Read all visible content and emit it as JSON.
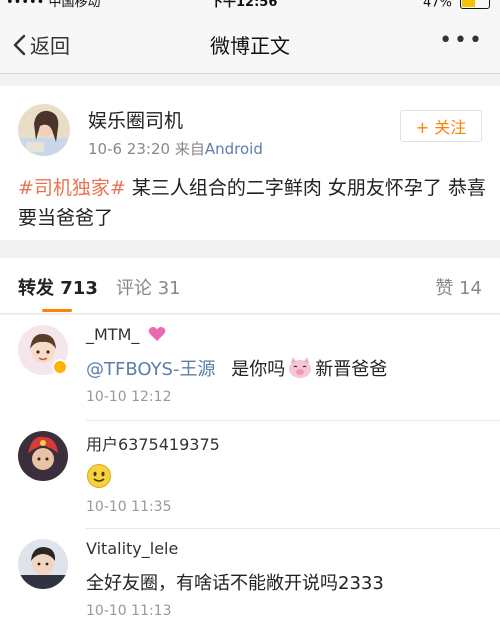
{
  "status_bar": {
    "carrier": "••••• 中国移动",
    "time": "下午12:56",
    "battery": "47%",
    "battery_level": 0.47
  },
  "nav": {
    "back_label": "返回",
    "title": "微博正文",
    "more_label": "•••"
  },
  "post": {
    "username": "娱乐圈司机",
    "time": "10-6 23:20",
    "source_prefix": "来自",
    "source": "Android",
    "follow_label": "+ 关注",
    "hashtag": "#司机独家#",
    "text": " 某三人组合的二字鲜肉 女朋友怀孕了 恭喜要当爸爸了"
  },
  "tabs": {
    "repost": "转发 713",
    "comment": "评论 31",
    "like": "赞 14"
  },
  "comments": [
    {
      "name": "_MTM_",
      "mention": "@TFBOYS-王源",
      "text_before": "是你吗",
      "text_after": "新晋爸爸",
      "time": "10-10 12:12"
    },
    {
      "name": "用户6375419375",
      "time": "10-10 11:35"
    },
    {
      "name": "Vitality_lele",
      "text": "全好友圈，有啥话不能敞开说吗2333",
      "time": "10-10 11:13"
    }
  ],
  "colors": {
    "accent": "#ff8200",
    "link": "#5a7ea8",
    "hashtag": "#eb7350"
  }
}
